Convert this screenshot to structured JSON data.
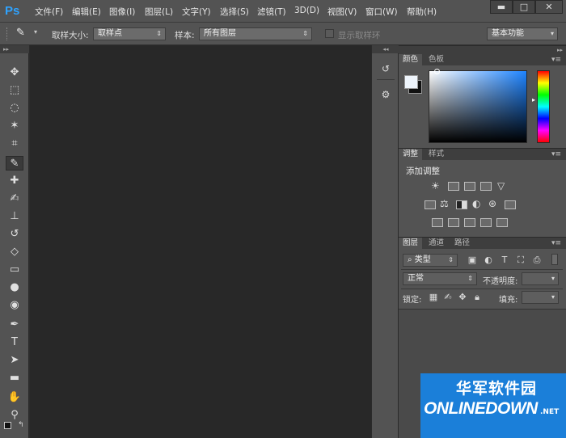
{
  "app": {
    "logo": "Ps"
  },
  "menu": [
    "文件(F)",
    "编辑(E)",
    "图像(I)",
    "图层(L)",
    "文字(Y)",
    "选择(S)",
    "滤镜(T)",
    "3D(D)",
    "视图(V)",
    "窗口(W)",
    "帮助(H)"
  ],
  "window_controls": {
    "minimize": "▬",
    "maximize": "□",
    "close": "✕"
  },
  "options": {
    "sample_size_label": "取样大小:",
    "sample_size_value": "取样点",
    "sample_label": "样本:",
    "sample_value": "所有图层",
    "show_ring_label": "显示取样环",
    "workspace": "基本功能"
  },
  "tools": [
    {
      "name": "move-tool",
      "glyph": "✥"
    },
    {
      "name": "marquee-tool",
      "glyph": "⬚"
    },
    {
      "name": "lasso-tool",
      "glyph": "◌"
    },
    {
      "name": "magic-wand-tool",
      "glyph": "✶"
    },
    {
      "name": "crop-tool",
      "glyph": "⌗"
    },
    {
      "name": "eyedropper-tool",
      "glyph": "✎"
    },
    {
      "name": "healing-brush-tool",
      "glyph": "✚"
    },
    {
      "name": "brush-tool",
      "glyph": "✍"
    },
    {
      "name": "clone-stamp-tool",
      "glyph": "⊥"
    },
    {
      "name": "history-brush-tool",
      "glyph": "↺"
    },
    {
      "name": "eraser-tool",
      "glyph": "◇"
    },
    {
      "name": "gradient-tool",
      "glyph": "▭"
    },
    {
      "name": "blur-tool",
      "glyph": "●"
    },
    {
      "name": "dodge-tool",
      "glyph": "◉"
    },
    {
      "name": "pen-tool",
      "glyph": "✒"
    },
    {
      "name": "type-tool",
      "glyph": "T"
    },
    {
      "name": "path-selection-tool",
      "glyph": "➤"
    },
    {
      "name": "rectangle-tool",
      "glyph": "▬"
    },
    {
      "name": "hand-tool",
      "glyph": "✋"
    },
    {
      "name": "zoom-tool",
      "glyph": "⚲"
    }
  ],
  "color_panel": {
    "tabs": [
      "颜色",
      "色板"
    ]
  },
  "adjust_panel": {
    "tabs": [
      "调整",
      "样式"
    ],
    "title": "添加调整"
  },
  "layers_panel": {
    "tabs": [
      "图层",
      "通道",
      "路径"
    ],
    "filter": "类型",
    "blend_mode": "正常",
    "opacity_label": "不透明度:",
    "lock_label": "锁定:",
    "fill_label": "填充:"
  },
  "watermark": {
    "cn": "华军软件园",
    "en": "ONLINEDOWN",
    "suffix": ".NET"
  },
  "colors": {
    "accent": "#2fa3ff",
    "panel": "#535353",
    "canvas": "#282828",
    "watermark_bg": "#1b7fd9"
  }
}
